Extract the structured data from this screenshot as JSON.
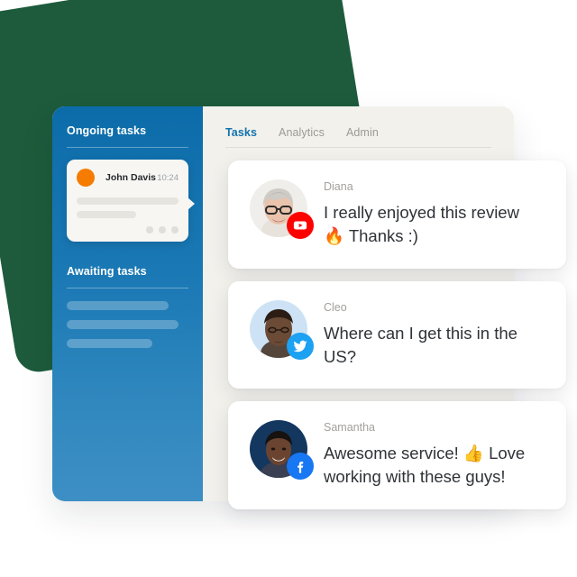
{
  "colors": {
    "green_backdrop": "#1d5b3c",
    "sidebar_top": "#0c6ca9",
    "sidebar_bottom": "#3d8fc4",
    "panel_bg": "#f2f1ec",
    "accent_tab": "#1173ae",
    "avatar_dot": "#f57c00",
    "youtube_red": "#ff0000",
    "twitter_blue": "#1da1f2",
    "facebook_blue": "#1877f2",
    "card_white": "#ffffff"
  },
  "sidebar": {
    "ongoing_heading": "Ongoing tasks",
    "task_card": {
      "name": "John Davis",
      "time": "10:24",
      "avatar_icon": "orange-circle-avatar",
      "dots_icon": "three-dots-icon",
      "skeleton_lines": 2
    },
    "awaiting_heading": "Awaiting tasks",
    "awaiting_placeholders": [
      {
        "width_pct": 84
      },
      {
        "width_pct": 92
      },
      {
        "width_pct": 70
      }
    ]
  },
  "main": {
    "tabs": [
      {
        "label": "Tasks",
        "active": true
      },
      {
        "label": "Analytics",
        "active": false
      },
      {
        "label": "Admin",
        "active": false
      }
    ]
  },
  "messages": [
    {
      "author": "Diana",
      "text": "I really enjoyed this review🔥 Thanks :)",
      "network": "youtube",
      "badge_icon": "youtube-icon",
      "avatar_icon": "avatar-diana",
      "avatar_bg": "#f0eeea"
    },
    {
      "author": "Cleo",
      "text": "Where can I get this in the US?",
      "network": "twitter",
      "badge_icon": "twitter-icon",
      "avatar_icon": "avatar-cleo",
      "avatar_bg": "#cde3f5"
    },
    {
      "author": "Samantha",
      "text": "Awesome service! 👍 Love working with these guys!",
      "network": "facebook",
      "badge_icon": "facebook-icon",
      "avatar_icon": "avatar-samantha",
      "avatar_bg": "#13375f"
    }
  ]
}
